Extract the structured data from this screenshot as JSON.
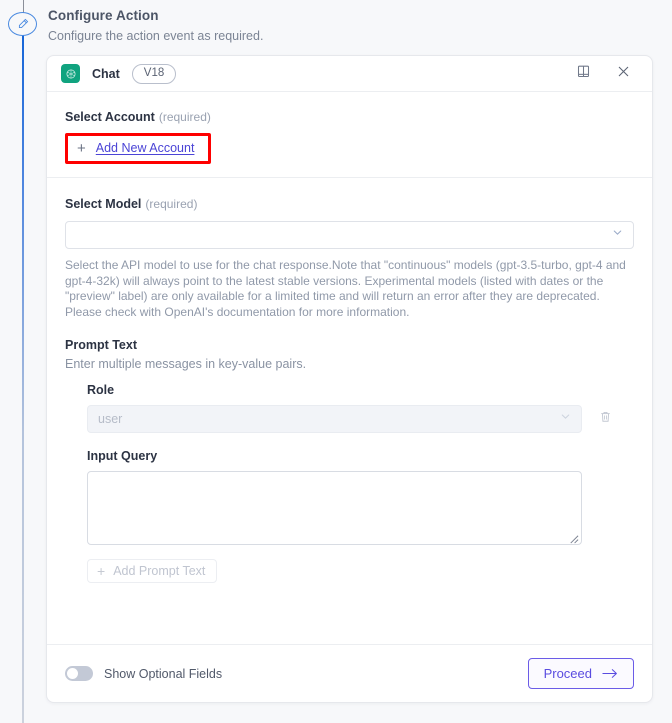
{
  "heading": {
    "title": "Configure Action",
    "subtitle": "Configure the action event as required.",
    "step_icon": "pencil-icon"
  },
  "card": {
    "header": {
      "app_icon": "openai-logo-icon",
      "app_name": "Chat",
      "version_badge": "V18",
      "docs_icon": "book-icon",
      "close_icon": "close-icon"
    },
    "account": {
      "label": "Select Account",
      "required_tag": "(required)",
      "add_icon": "plus-icon",
      "add_label": "Add New Account",
      "highlight_color": "#fe0000"
    },
    "model": {
      "label": "Select Model",
      "required_tag": "(required)",
      "value": "",
      "placeholder": "",
      "chevron_icon": "chevron-down-icon",
      "help_text": "Select the API model to use for the chat response.Note that \"continuous\" models (gpt-3.5-turbo, gpt-4 and gpt-4-32k) will always point to the latest stable versions. Experimental models (listed with dates or the \"preview\" label) are only available for a limited time and will return an error after they are deprecated. Please check with OpenAI's documentation for more information."
    },
    "prompt": {
      "label": "Prompt Text",
      "sub_label": "Enter multiple messages in key-value pairs.",
      "role": {
        "label": "Role",
        "value": "user",
        "chevron_icon": "chevron-down-icon",
        "delete_icon": "trash-icon"
      },
      "query": {
        "label": "Input Query",
        "value": "",
        "placeholder": "",
        "resize_icon": "resize-handle-icon"
      },
      "add_button": {
        "icon": "plus-icon",
        "label": "Add Prompt Text"
      }
    },
    "footer": {
      "toggle_label": "Show Optional Fields",
      "toggle_state": "off",
      "proceed_label": "Proceed",
      "proceed_arrow_icon": "arrow-right-icon",
      "accent_color": "#5a4ce0"
    }
  }
}
